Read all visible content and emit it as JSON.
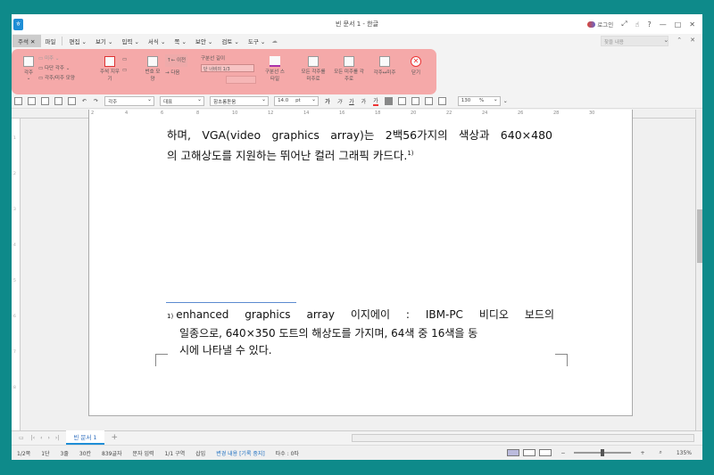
{
  "window": {
    "title": "빈 문서 1 - 한글",
    "login": "로그인"
  },
  "menu": {
    "active_tab": "주석",
    "items": [
      "파일",
      "편집 ⌄",
      "보기 ⌄",
      "입력 ⌄",
      "서식 ⌄",
      "쪽 ⌄",
      "보안 ⌄",
      "검토 ⌄",
      "도구 ⌄"
    ],
    "search_placeholder": "찾을 내용"
  },
  "ribbon": {
    "footnote": "각주",
    "endnote": "미주",
    "multi_footnote": "다단 각주 ⌄",
    "note_shape": "각주/미주 모양",
    "delete_note": "주석 지우기",
    "number_shape": "번호 모양",
    "prev": "이전",
    "next": "다음",
    "separator_length_label": "구분선 길이",
    "separator_length_value": "단 너비의 1/3",
    "separator_style": "구분선 스타일",
    "all_to_endnote": "모든 각주를 미주로",
    "all_to_footnote": "모든 미주를 각주로",
    "swap": "각주↔미주",
    "close": "닫기"
  },
  "toolbar": {
    "style": "각주",
    "lang": "대표",
    "font": "함초롬돋움",
    "size": "14.0",
    "unit": "pt",
    "zoom": "130",
    "zoom_unit": "%"
  },
  "document": {
    "line1": "하며, VGA(video graphics array)는 2백56가지의 색상과 640×480",
    "line2": "의 고해상도를 지원하는 뛰어난 컬러 그래픽 카드다.",
    "footnote_ref": "1)",
    "footnote_num": "1)",
    "fn_line1": "enhanced graphics array 이지에이 : IBM-PC 비디오 보드의",
    "fn_line2": "일종으로, 640×350 도트의 해상도를 가지며, 64색 중 16색을 동",
    "fn_line3": "시에 나타낼 수 있다."
  },
  "tabs": {
    "doc_tab": "빈 문서 1",
    "add": "+"
  },
  "status": {
    "page": "1/2쪽",
    "column": "1단",
    "line": "3줄",
    "col": "30칸",
    "chars": "839글자",
    "mode": "문자 입력",
    "section": "1/1 구역",
    "insert": "삽입",
    "track": "변경 내용 [기록 중지]",
    "typo": "타수 : 0타",
    "zoom": "135%"
  }
}
